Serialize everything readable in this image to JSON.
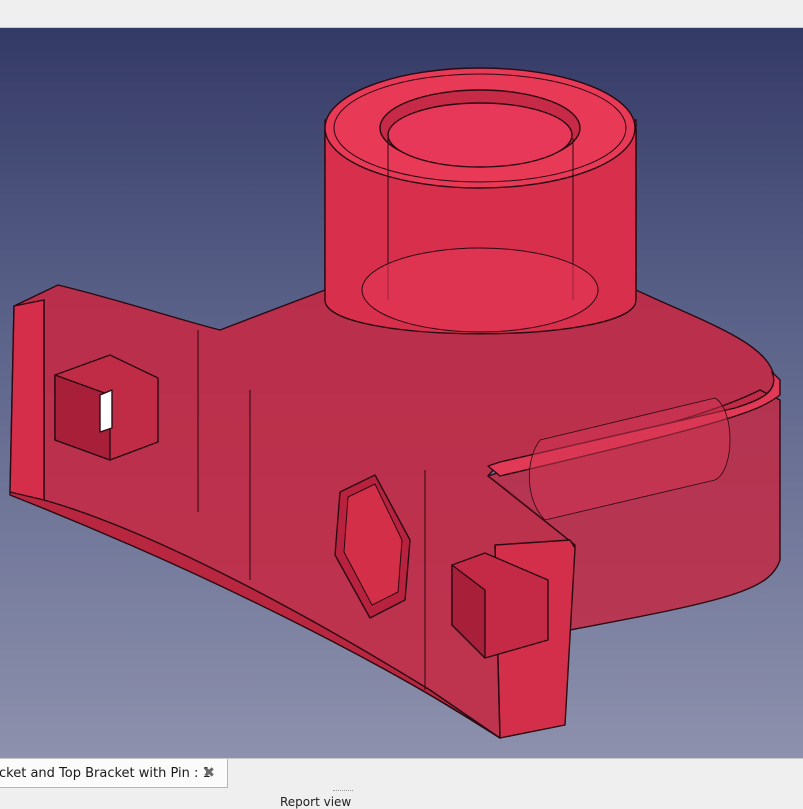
{
  "viewport": {
    "background_top": "#343a66",
    "background_bottom": "#8d91ad",
    "model_color": "#e2314d"
  },
  "tab": {
    "label": "cket and Top Bracket with Pin : 1",
    "close_icon": "close-icon"
  },
  "report_view": {
    "label": "Report view"
  }
}
